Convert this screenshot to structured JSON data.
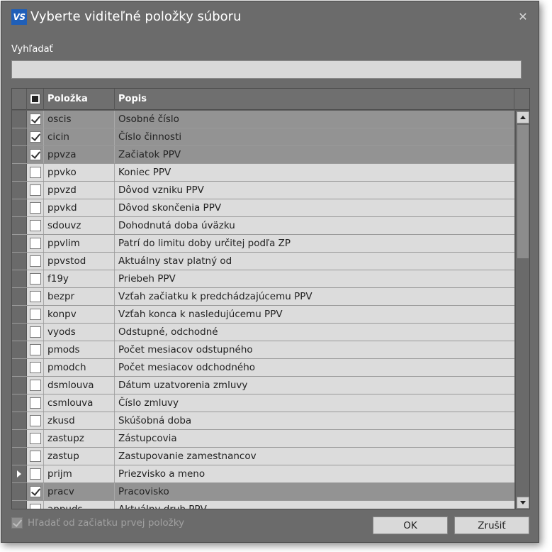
{
  "window": {
    "logo_text": "VS",
    "title": "Vyberte viditeľné položky súboru",
    "close_symbol": "✕"
  },
  "search": {
    "label": "Vyhľadať",
    "value": "",
    "placeholder": ""
  },
  "grid": {
    "columns": [
      "Položka",
      "Popis"
    ],
    "rows": [
      {
        "item": "oscis",
        "desc": "Osobné číslo",
        "checked": true,
        "current": false
      },
      {
        "item": "cicin",
        "desc": "Číslo činnosti",
        "checked": true,
        "current": false
      },
      {
        "item": "ppvza",
        "desc": "Začiatok PPV",
        "checked": true,
        "current": false
      },
      {
        "item": "ppvko",
        "desc": "Koniec PPV",
        "checked": false,
        "current": false
      },
      {
        "item": "ppvzd",
        "desc": "Dôvod vzniku PPV",
        "checked": false,
        "current": false
      },
      {
        "item": "ppvkd",
        "desc": "Dôvod skončenia PPV",
        "checked": false,
        "current": false
      },
      {
        "item": "sdouvz",
        "desc": "Dohodnutá doba úväzku",
        "checked": false,
        "current": false
      },
      {
        "item": "ppvlim",
        "desc": "Patrí do limitu doby určitej podľa ZP",
        "checked": false,
        "current": false
      },
      {
        "item": "ppvstod",
        "desc": "Aktuálny stav platný od",
        "checked": false,
        "current": false
      },
      {
        "item": "f19y",
        "desc": "Priebeh PPV",
        "checked": false,
        "current": false
      },
      {
        "item": "bezpr",
        "desc": "Vzťah začiatku k predchádzajúcemu PPV",
        "checked": false,
        "current": false
      },
      {
        "item": "konpv",
        "desc": "Vzťah konca k nasledujúcemu PPV",
        "checked": false,
        "current": false
      },
      {
        "item": "vyods",
        "desc": "Odstupné, odchodné",
        "checked": false,
        "current": false
      },
      {
        "item": "pmods",
        "desc": "Počet mesiacov odstupného",
        "checked": false,
        "current": false
      },
      {
        "item": "pmodch",
        "desc": "Počet mesiacov odchodného",
        "checked": false,
        "current": false
      },
      {
        "item": "dsmlouva",
        "desc": "Dátum uzatvorenia zmluvy",
        "checked": false,
        "current": false
      },
      {
        "item": "csmlouva",
        "desc": "Číslo zmluvy",
        "checked": false,
        "current": false
      },
      {
        "item": "zkusd",
        "desc": "Skúšobná doba",
        "checked": false,
        "current": false
      },
      {
        "item": "zastupz",
        "desc": "Zástupcovia",
        "checked": false,
        "current": false
      },
      {
        "item": "zastup",
        "desc": "Zastupovanie zamestnancov",
        "checked": false,
        "current": false
      },
      {
        "item": "prijm",
        "desc": "Priezvisko a meno",
        "checked": false,
        "current": true
      },
      {
        "item": "pracv",
        "desc": "Pracovisko",
        "checked": true,
        "current": false
      },
      {
        "item": "appuds",
        "desc": "Aktuálny druh PPV",
        "checked": false,
        "current": false
      }
    ]
  },
  "footer": {
    "search_from_start_label": "Hľadať od začiatku prvej položky",
    "search_from_start_checked": true,
    "ok_label": "OK",
    "cancel_label": "Zrušiť"
  },
  "colors": {
    "dialog_bg": "#6b6b6b",
    "row_bg": "#dcdcdc",
    "row_checked_bg": "#939393",
    "logo_bg": "#1f5fb8"
  },
  "icons": {
    "close": "close-icon",
    "row_indicator": "caret-right-icon",
    "scroll_up": "arrow-up-icon",
    "scroll_down": "arrow-down-icon"
  }
}
